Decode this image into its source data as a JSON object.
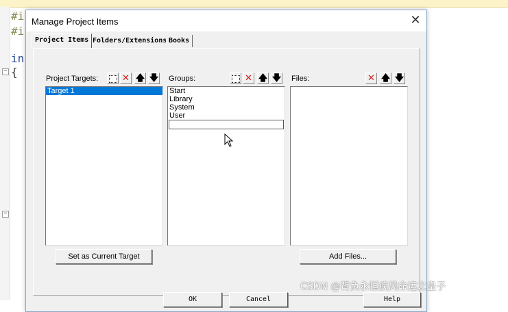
{
  "editor": {
    "line1": "#i",
    "line2": "#i",
    "line3": "in",
    "line4": "{"
  },
  "dialog": {
    "title": "Manage Project Items",
    "close_glyph": "✕",
    "tabs": [
      {
        "label": "Project Items",
        "active": true
      },
      {
        "label": "Folders/Extensions",
        "active": false
      },
      {
        "label": "Books",
        "active": false
      }
    ],
    "targets": {
      "label": "Project Targets:",
      "items": [
        "Target 1"
      ],
      "selected": "Target 1"
    },
    "groups": {
      "label": "Groups:",
      "items": [
        "Start",
        "Library",
        "System",
        "User"
      ],
      "edit_value": ""
    },
    "files": {
      "label": "Files:",
      "items": []
    },
    "buttons": {
      "set_current_target": "Set as Current Target",
      "add_files": "Add Files...",
      "ok": "OK",
      "cancel": "Cancel",
      "help": "Help"
    },
    "icons": {
      "new": "new-item-icon",
      "delete": "delete-icon",
      "up": "move-up-icon",
      "down": "move-down-icon",
      "delete_glyph": "✕",
      "up_glyph": "🡅",
      "down_glyph": "🡇"
    }
  },
  "watermark": "CSDN @背负永恒疾风命运之皇子",
  "colors": {
    "selection": "#0078d7",
    "delete_red": "#cc1a1a",
    "dialog_bg": "#f0f0f0"
  }
}
